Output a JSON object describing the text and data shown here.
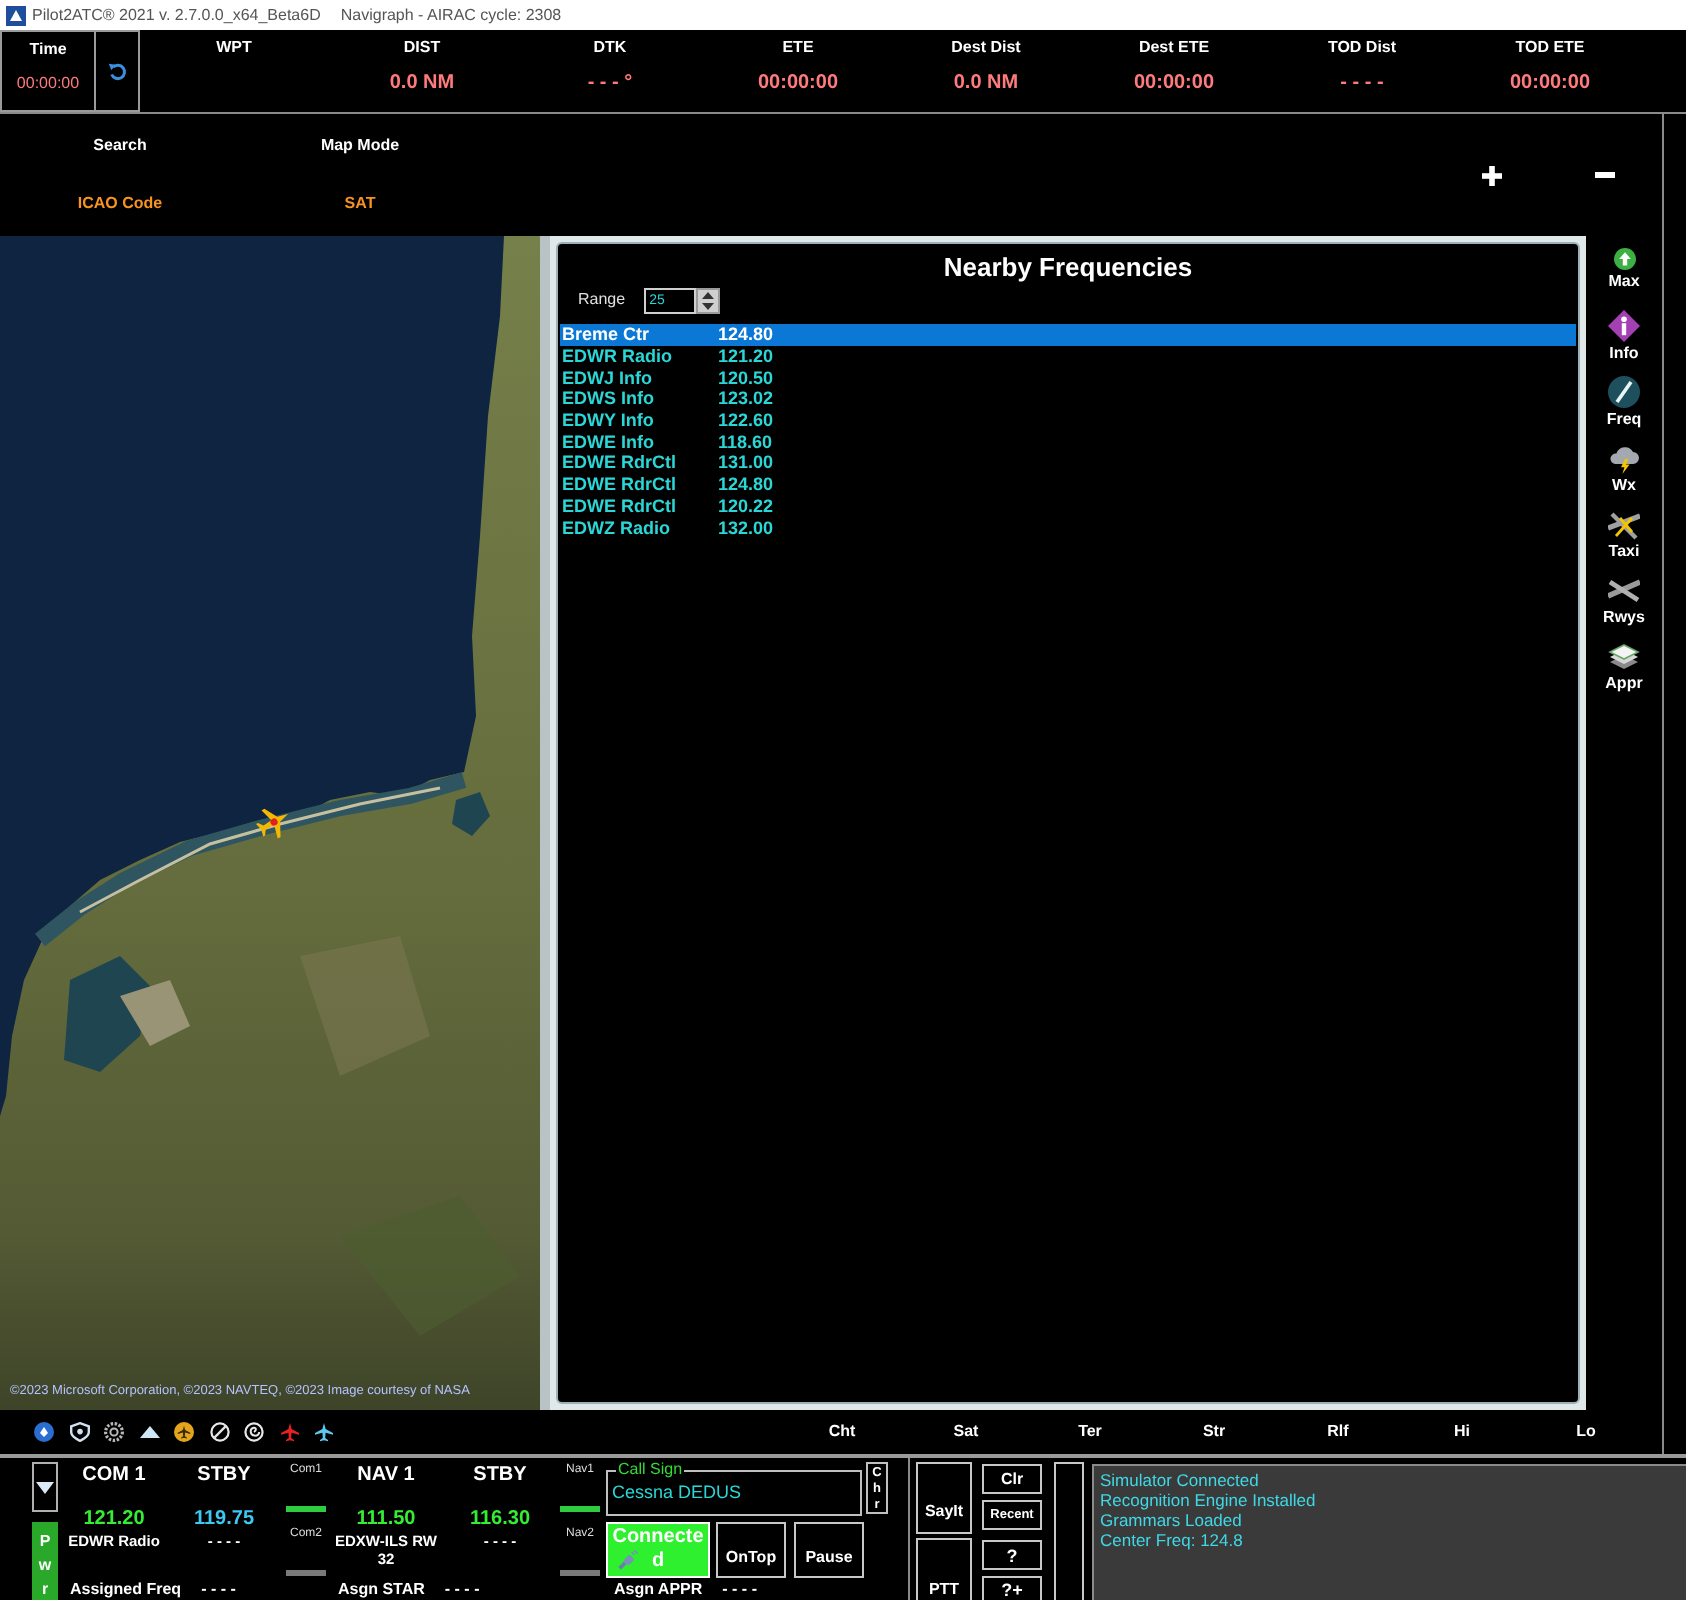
{
  "title_bar": {
    "app": "Pilot2ATC® 2021 v. 2.7.0.0_x64_Beta6D",
    "nav_data": "Navigraph - AIRAC cycle: 2308"
  },
  "info_bar": {
    "time": {
      "label": "Time",
      "value": "00:00:00"
    },
    "fields": [
      {
        "label": "WPT"
      },
      {
        "label": "DIST",
        "value": "0.0 NM"
      },
      {
        "label": "DTK",
        "value": "- - - °"
      },
      {
        "label": "ETE",
        "value": "00:00:00"
      },
      {
        "label": "Dest Dist",
        "value": "0.0 NM"
      },
      {
        "label": "Dest ETE",
        "value": "00:00:00"
      },
      {
        "label": "TOD Dist",
        "value": "- - - -"
      },
      {
        "label": "TOD ETE",
        "value": "00:00:00"
      }
    ]
  },
  "map_header": {
    "search": {
      "label": "Search",
      "value": "ICAO Code"
    },
    "map_mode": {
      "label": "Map Mode",
      "value": "SAT"
    }
  },
  "map": {
    "attribution": "©2023 Microsoft Corporation, ©2023 NAVTEQ, ©2023 Image courtesy of NASA"
  },
  "frequencies_panel": {
    "title": "Nearby Frequencies",
    "range": {
      "label": "Range",
      "value": "25"
    },
    "rows": [
      {
        "station": "Breme Ctr",
        "frequency": "124.80",
        "selected": true
      },
      {
        "station": "EDWR Radio",
        "frequency": "121.20",
        "selected": false
      },
      {
        "station": "EDWJ Info",
        "frequency": "120.50",
        "selected": false
      },
      {
        "station": "EDWS Info",
        "frequency": "123.02",
        "selected": false
      },
      {
        "station": "EDWY Info",
        "frequency": "122.60",
        "selected": false
      },
      {
        "station": "EDWE Info",
        "frequency": "118.60",
        "selected": false
      },
      {
        "station": "EDWE RdrCtl",
        "frequency": "131.00",
        "selected": false
      },
      {
        "station": "EDWE RdrCtl",
        "frequency": "124.80",
        "selected": false
      },
      {
        "station": "EDWE RdrCtl",
        "frequency": "120.22",
        "selected": false
      },
      {
        "station": "EDWZ Radio",
        "frequency": "132.00",
        "selected": false
      }
    ]
  },
  "side_tools": [
    {
      "kind": "max",
      "label": "Max"
    },
    {
      "kind": "info",
      "label": "Info"
    },
    {
      "kind": "freq",
      "label": "Freq"
    },
    {
      "kind": "wx",
      "label": "Wx"
    },
    {
      "kind": "taxi",
      "label": "Taxi"
    },
    {
      "kind": "rwys",
      "label": "Rwys"
    },
    {
      "kind": "appr",
      "label": "Appr"
    }
  ],
  "map_layers": [
    "Cht",
    "Sat",
    "Ter",
    "Str",
    "Rlf",
    "Hi",
    "Lo"
  ],
  "radio_panel": {
    "power": "Pwr",
    "radio_groups": [
      {
        "radios": [
          {
            "label": "COM 1",
            "frequency": "121.20",
            "station": "EDWR Radio",
            "color": "#33ee33"
          },
          {
            "label": "STBY",
            "frequency": "119.75",
            "station": "- - - -",
            "color": "#3cc8f0"
          }
        ],
        "switches": [
          {
            "label": "Com1",
            "on": true
          },
          {
            "label": "Com2",
            "on": false
          }
        ]
      },
      {
        "radios": [
          {
            "label": "NAV 1",
            "frequency": "111.50",
            "station": "EDXW-ILS RW 32",
            "color": "#33ee33"
          },
          {
            "label": "STBY",
            "frequency": "116.30",
            "station": "- - - -",
            "color": "#33ee33"
          }
        ],
        "switches": [
          {
            "label": "Nav1",
            "on": true
          },
          {
            "label": "Nav2",
            "on": false
          }
        ]
      }
    ],
    "call_sign": {
      "label": "Call Sign",
      "value": "Cessna DEDUS"
    },
    "chr": "Chr",
    "connection": {
      "label": "Connected",
      "connected": true
    },
    "buttons": [
      "OnTop",
      "Pause"
    ],
    "assignments": [
      {
        "label": "Assigned Freq",
        "value": "- - - -"
      },
      {
        "label": "Asgn STAR",
        "value": "- - - -"
      },
      {
        "label": "Asgn APPR",
        "value": "- - - -"
      }
    ]
  },
  "voice_panel": {
    "say_it": "SayIt",
    "ptt": "PTT",
    "clear": "Clr",
    "recent": "Recent",
    "help": "?",
    "help_more": "?+",
    "messages": [
      "Simulator Connected",
      "Recognition Engine Installed",
      "Grammars Loaded",
      "Center Freq: 124.8"
    ]
  }
}
